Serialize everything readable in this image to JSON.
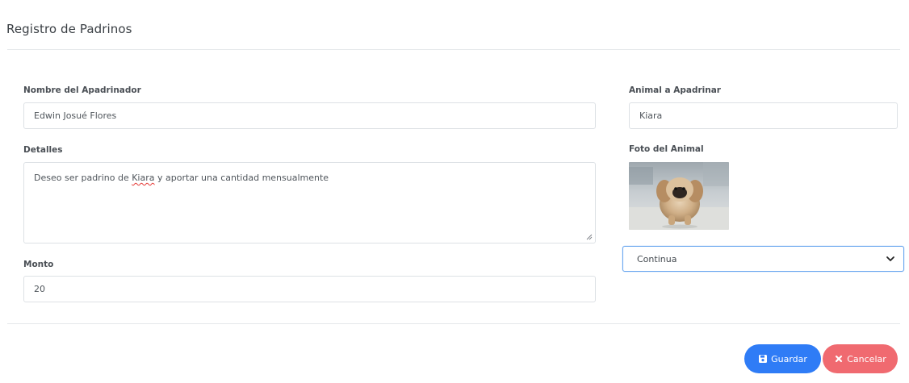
{
  "header": {
    "title": "Registro de Padrinos"
  },
  "form": {
    "padrino": {
      "label": "Nombre del Apadrinador",
      "value": "Edwin Josué Flores"
    },
    "detalles": {
      "label": "Detalles",
      "value_before": "Deseo ser padrino de ",
      "value_misspelled": "Kiara",
      "value_after": " y aportar una cantidad mensualmente"
    },
    "monto": {
      "label": "Monto",
      "value": "20"
    },
    "animal": {
      "label": "Animal a Apadrinar",
      "value": "Kiara"
    },
    "foto": {
      "label": "Foto del Animal",
      "alt": "Pekingese dog photo"
    },
    "frecuencia": {
      "selected": "Continua"
    }
  },
  "actions": {
    "save_label": "Guardar",
    "cancel_label": "Cancelar",
    "save_icon": "floppy-disk-icon",
    "cancel_icon": "x-icon",
    "save_color": "#2f7cf6",
    "cancel_color": "#f06a70"
  }
}
